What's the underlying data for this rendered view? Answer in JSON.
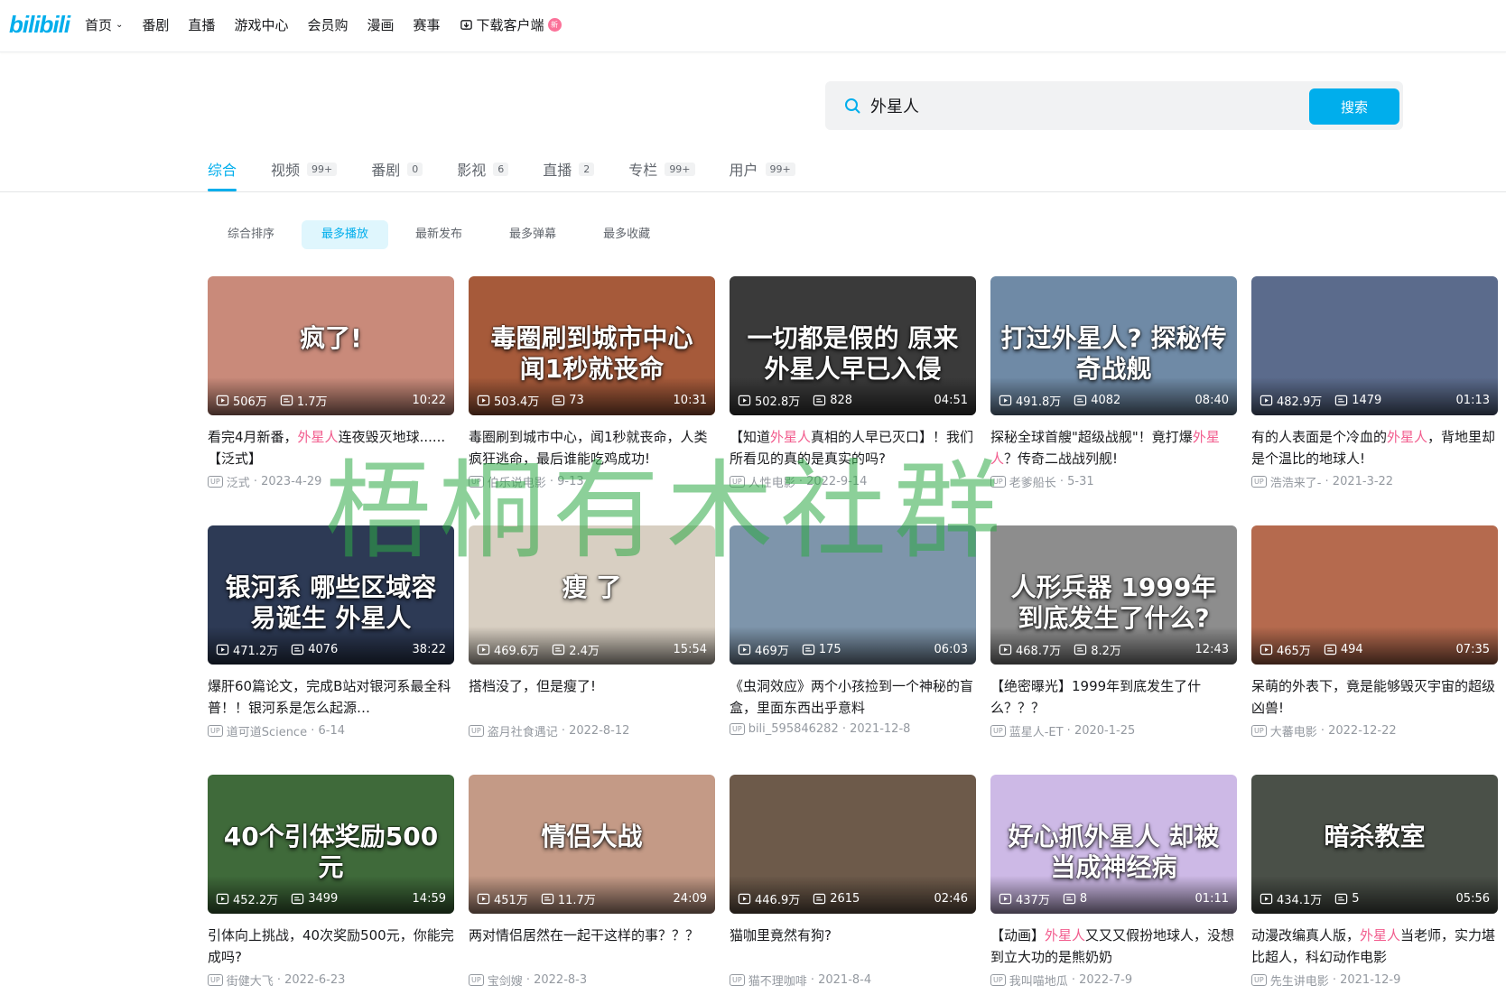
{
  "header": {
    "logo": "bilibili",
    "nav": [
      {
        "label": "首页",
        "dropdown": true
      },
      {
        "label": "番剧"
      },
      {
        "label": "直播"
      },
      {
        "label": "游戏中心"
      },
      {
        "label": "会员购"
      },
      {
        "label": "漫画"
      },
      {
        "label": "赛事"
      }
    ],
    "download": {
      "label": "下载客户端",
      "badge": "新"
    }
  },
  "search": {
    "value": "外星人",
    "button": "搜索"
  },
  "tabs": [
    {
      "label": "综合",
      "count": "",
      "active": true
    },
    {
      "label": "视频",
      "count": "99+"
    },
    {
      "label": "番剧",
      "count": "0"
    },
    {
      "label": "影视",
      "count": "6"
    },
    {
      "label": "直播",
      "count": "2"
    },
    {
      "label": "专栏",
      "count": "99+"
    },
    {
      "label": "用户",
      "count": "99+"
    }
  ],
  "sorts": [
    {
      "label": "综合排序"
    },
    {
      "label": "最多播放",
      "active": true
    },
    {
      "label": "最新发布"
    },
    {
      "label": "最多弹幕"
    },
    {
      "label": "最多收藏"
    }
  ],
  "colors": {
    "accent": "#00aeec",
    "highlight": "#f25d8e",
    "meta": "#9499a0"
  },
  "videos": [
    {
      "caption": "疯了!",
      "bg": "#c98a7a",
      "plays": "506万",
      "danmaku": "1.7万",
      "duration": "10:22",
      "title": [
        "看完4月新番，",
        "外星人",
        "连夜毁灭地球......【泛式】"
      ],
      "author": "泛式",
      "date": "2023-4-29"
    },
    {
      "caption": "毒圈刷到城市中心 闻1秒就丧命",
      "bg": "#a65a3a",
      "plays": "503.4万",
      "danmaku": "73",
      "duration": "10:31",
      "title": [
        "毒圈刷到城市中心，闻1秒就丧命，人类疯狂逃命，最后谁能吃鸡成功!",
        "",
        ""
      ],
      "author": "伯乐说电影",
      "date": "9-13"
    },
    {
      "caption": "一切都是假的 原来外星人早已入侵",
      "bg": "#3a3a3a",
      "plays": "502.8万",
      "danmaku": "828",
      "duration": "04:51",
      "title": [
        "【知道",
        "外星人",
        "真相的人早已灭口】！我们所看见的真的是真实的吗?"
      ],
      "author": "人性电影",
      "date": "2022-9-14"
    },
    {
      "caption": "打过外星人? 探秘传奇战舰",
      "bg": "#6f8aa6",
      "plays": "491.8万",
      "danmaku": "4082",
      "duration": "08:40",
      "title": [
        "探秘全球首艘\"超级战舰\"！竟打爆",
        "外星人",
        "？传奇二战战列舰!"
      ],
      "author": "老爹船长",
      "date": "5-31"
    },
    {
      "caption": "",
      "bg": "#5b6b8c",
      "plays": "482.9万",
      "danmaku": "1479",
      "duration": "01:13",
      "title": [
        "有的人表面是个冷血的",
        "外星人",
        "，背地里却是个温比的地球人!"
      ],
      "author": "浩浩来了-",
      "date": "2021-3-22"
    },
    {
      "caption": "银河系 哪些区域容易诞生 外星人",
      "bg": "#2d3a55",
      "plays": "471.2万",
      "danmaku": "4076",
      "duration": "38:22",
      "title": [
        "爆肝60篇论文，完成B站对银河系最全科普！！银河系是怎么起源…",
        "",
        ""
      ],
      "author": "道可道Science",
      "date": "6-14"
    },
    {
      "caption": "瘦 了",
      "bg": "#d8cfc2",
      "plays": "469.6万",
      "danmaku": "2.4万",
      "duration": "15:54",
      "title": [
        "搭档没了，但是瘦了!",
        "",
        ""
      ],
      "author": "盗月社食遇记",
      "date": "2022-8-12"
    },
    {
      "caption": "",
      "bg": "#7e95ab",
      "plays": "469万",
      "danmaku": "175",
      "duration": "06:03",
      "title": [
        "《虫洞效应》两个小孩捡到一个神秘的盲盒，里面东西出乎意料",
        "",
        ""
      ],
      "author": "bili_595846282",
      "date": "2021-12-8"
    },
    {
      "caption": "人形兵器 1999年到底发生了什么?",
      "bg": "#8d8d8d",
      "plays": "468.7万",
      "danmaku": "8.2万",
      "duration": "12:43",
      "title": [
        "【绝密曝光】1999年到底发生了什么？？？",
        "",
        ""
      ],
      "author": "蓝星人-ET",
      "date": "2020-1-25"
    },
    {
      "caption": "",
      "bg": "#b56a4e",
      "plays": "465万",
      "danmaku": "494",
      "duration": "07:35",
      "title": [
        "呆萌的外表下，竟是能够毁灭宇宙的超级凶兽!",
        "",
        ""
      ],
      "author": "大蕃电影",
      "date": "2022-12-22"
    },
    {
      "caption": "40个引体奖励500元",
      "bg": "#3f6a3a",
      "plays": "452.2万",
      "danmaku": "3499",
      "duration": "14:59",
      "title": [
        "引体向上挑战，40次奖励500元，你能完成吗?",
        "",
        ""
      ],
      "author": "街健大飞",
      "date": "2022-6-23"
    },
    {
      "caption": "情侣大战",
      "bg": "#c49a86",
      "plays": "451万",
      "danmaku": "11.7万",
      "duration": "24:09",
      "title": [
        "两对情侣居然在一起干这样的事？？？",
        "",
        ""
      ],
      "author": "宝剑嫂",
      "date": "2022-8-3"
    },
    {
      "caption": "",
      "bg": "#6d5a4a",
      "plays": "446.9万",
      "danmaku": "2615",
      "duration": "02:46",
      "title": [
        "猫咖里竟然有狗?",
        "",
        ""
      ],
      "author": "猫不理咖啡",
      "date": "2021-8-4"
    },
    {
      "caption": "好心抓外星人 却被当成神经病",
      "bg": "#cdb9e6",
      "plays": "437万",
      "danmaku": "8",
      "duration": "01:11",
      "title": [
        "【动画】",
        "外星人",
        "又又又假扮地球人，没想到立大功的是熊奶奶"
      ],
      "author": "我叫喵地瓜",
      "date": "2022-7-9"
    },
    {
      "caption": "暗杀教室",
      "bg": "#4a5048",
      "plays": "434.1万",
      "danmaku": "5",
      "duration": "05:56",
      "title": [
        "动漫改编真人版，",
        "外星人",
        "当老师，实力堪比超人，科幻动作电影"
      ],
      "author": "先生讲电影",
      "date": "2021-12-9"
    }
  ],
  "watermark": "梧桐有木社群"
}
